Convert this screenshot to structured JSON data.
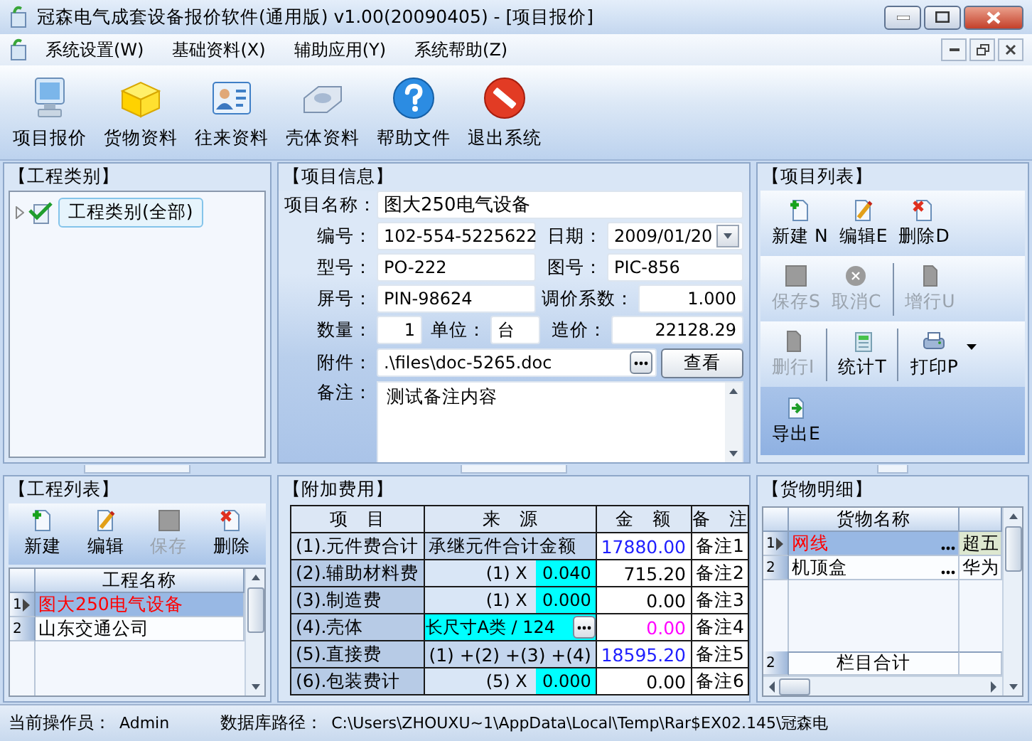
{
  "window": {
    "title": "冠森电气成套设备报价软件(通用版) v1.00(20090405) - [项目报价]"
  },
  "menu": [
    "系统设置(W)",
    "基础资料(X)",
    "辅助应用(Y)",
    "系统帮助(Z)"
  ],
  "toolbar": [
    {
      "label": "项目报价",
      "kind": "monitor"
    },
    {
      "label": "货物资料",
      "kind": "box"
    },
    {
      "label": "往来资料",
      "kind": "card"
    },
    {
      "label": "壳体资料",
      "kind": "tray"
    },
    {
      "label": "帮助文件",
      "kind": "help"
    },
    {
      "label": "退出系统",
      "kind": "stop"
    }
  ],
  "category_panel": {
    "title": "【工程类别】",
    "tree": [
      {
        "label": "工程类别(全部)",
        "checked": true,
        "selected": true
      }
    ]
  },
  "project_panel": {
    "title": "【工程列表】",
    "buttons": [
      {
        "label": "新建",
        "kind": "new",
        "disabled": false
      },
      {
        "label": "编辑",
        "kind": "edit",
        "disabled": false
      },
      {
        "label": "保存",
        "kind": "save",
        "disabled": true
      },
      {
        "label": "删除",
        "kind": "delete",
        "disabled": false
      }
    ],
    "column": "工程名称",
    "rows": [
      {
        "index": "1",
        "name": "图大250电气设备",
        "selected": true
      },
      {
        "index": "2",
        "name": "山东交通公司",
        "selected": false
      }
    ]
  },
  "info_panel": {
    "title": "【项目信息】",
    "name": {
      "label": "项目名称：",
      "value": "图大250电气设备"
    },
    "code": {
      "label": "编号：",
      "value": "102-554-5225622"
    },
    "date": {
      "label": "日期：",
      "value": "2009/01/20"
    },
    "model": {
      "label": "型号：",
      "value": "PO-222"
    },
    "drawing_no": {
      "label": "图号：",
      "value": "PIC-856"
    },
    "panel_no": {
      "label": "屏号：",
      "value": "PIN-98624"
    },
    "price_factor": {
      "label": "调价系数：",
      "value": "1.000"
    },
    "quantity": {
      "label": "数量：",
      "value": "1"
    },
    "unit": {
      "label": "单位：",
      "value": "台"
    },
    "cost": {
      "label": "造价：",
      "value": "22128.29"
    },
    "attachment": {
      "label": "附件：",
      "value": ".\\files\\doc-5265.doc",
      "button": "查看"
    },
    "remark": {
      "label": "备注：",
      "value": "测试备注内容"
    }
  },
  "fees_panel": {
    "title": "【附加费用】",
    "columns": [
      "项　目",
      "来　源",
      "金　额",
      "备　注"
    ],
    "rows": [
      {
        "kind": "text",
        "item": "(1).元件费合计",
        "source": "承继元件合计金额",
        "amount": "17880.00",
        "color": "#2020ff",
        "note": "备注1"
      },
      {
        "kind": "rate",
        "item": "(2).辅助材料费",
        "source": "(1) X",
        "rate": "0.040",
        "amount": "715.20",
        "color": "#000000",
        "note": "备注2"
      },
      {
        "kind": "rate",
        "item": "(3).制造费",
        "source": "(1) X",
        "rate": "0.000",
        "amount": "0.00",
        "color": "#000000",
        "note": "备注3"
      },
      {
        "kind": "picker",
        "item": "(4).壳体",
        "source": "长尺寸A类 / 124",
        "amount": "0.00",
        "color": "#ff00ff",
        "note": "备注4"
      },
      {
        "kind": "text",
        "item": "(5).直接费",
        "source": "(1) +(2) +(3) +(4)",
        "amount": "18595.20",
        "color": "#2020ff",
        "note": "备注5"
      },
      {
        "kind": "rate",
        "item": "(6).包装费计",
        "source": "(5) X",
        "rate": "0.000",
        "amount": "0.00",
        "color": "#000000",
        "note": "备注6"
      }
    ]
  },
  "list_panel": {
    "title": "【项目列表】",
    "toolbar_rows": [
      {
        "buttons": [
          {
            "label": "新建 N",
            "kind": "new",
            "disabled": false,
            "separator": false
          },
          {
            "label": "编辑E",
            "kind": "edit",
            "disabled": false,
            "separator": false
          },
          {
            "label": "删除D",
            "kind": "delete",
            "disabled": false,
            "separator": false
          }
        ]
      },
      {
        "buttons": [
          {
            "label": "保存S",
            "kind": "save",
            "disabled": true,
            "separator": false
          },
          {
            "label": "取消C",
            "kind": "cancel",
            "disabled": true,
            "separator": false
          },
          {
            "label": "增行U",
            "kind": "page",
            "disabled": true,
            "separator": true
          }
        ]
      },
      {
        "buttons": [
          {
            "label": "删行I",
            "kind": "page",
            "disabled": true,
            "separator": false
          },
          {
            "label": "统计T",
            "kind": "stats",
            "disabled": false,
            "separator": true
          },
          {
            "label": "打印P",
            "kind": "print",
            "disabled": false,
            "separator": true,
            "dropdown": true
          }
        ]
      },
      {
        "buttons": [
          {
            "label": "导出E",
            "kind": "export",
            "disabled": false,
            "separator": false
          }
        ]
      }
    ]
  },
  "goods_panel": {
    "title": "【货物明细】",
    "column": "货物名称",
    "rows": [
      {
        "index": "1",
        "name": "网线",
        "column_2": "超五",
        "selected": true
      },
      {
        "index": "2",
        "name": "机顶盒",
        "column_2": "华为",
        "selected": false
      }
    ],
    "footer": {
      "index": "2",
      "label": "栏目合计"
    }
  },
  "status_bar": {
    "operator_label": "当前操作员：",
    "operator": "Admin",
    "db_label": "数据库路径：",
    "db_path": "C:\\Users\\ZHOUXU~1\\AppData\\Local\\Temp\\Rar$EX02.145\\冠森电"
  }
}
